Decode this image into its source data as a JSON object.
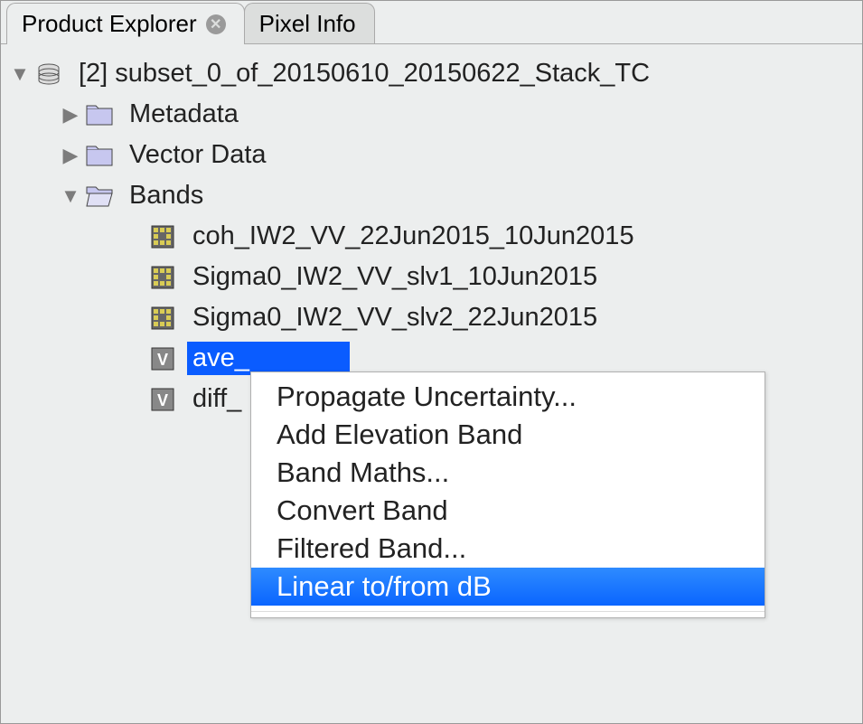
{
  "tabs": {
    "product_explorer": "Product Explorer",
    "pixel_info": "Pixel Info"
  },
  "tree": {
    "product_label": "[2] subset_0_of_20150610_20150622_Stack_TC",
    "metadata": "Metadata",
    "vector_data": "Vector Data",
    "bands": "Bands",
    "band_items": {
      "coh": "coh_IW2_VV_22Jun2015_10Jun2015",
      "sigma1": "Sigma0_IW2_VV_slv1_10Jun2015",
      "sigma2": "Sigma0_IW2_VV_slv2_22Jun2015",
      "ave": "ave_",
      "diff": "diff_"
    }
  },
  "context_menu": {
    "propagate": "Propagate Uncertainty...",
    "elevation": "Add Elevation Band",
    "band_maths": "Band Maths...",
    "convert": "Convert Band",
    "filtered": "Filtered Band...",
    "linear": "Linear to/from dB"
  }
}
